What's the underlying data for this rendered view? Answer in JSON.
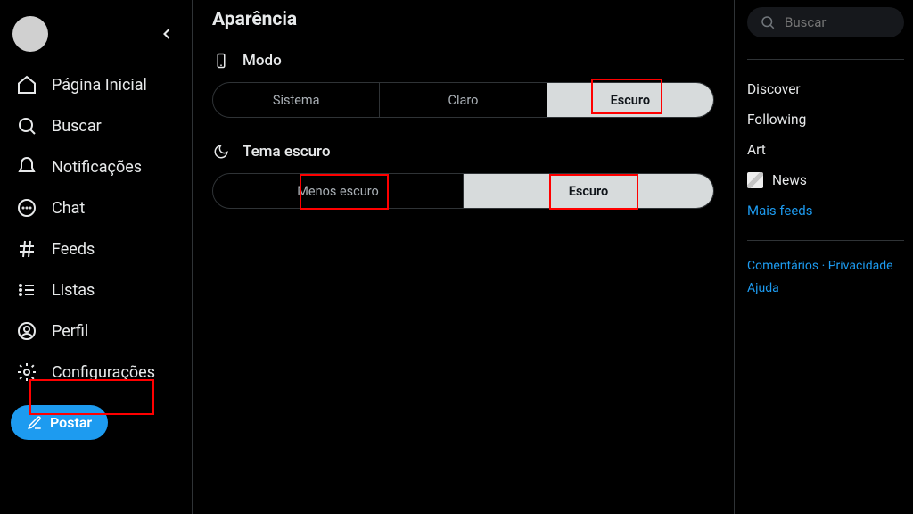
{
  "sidebar": {
    "nav": [
      {
        "label": "Página Inicial"
      },
      {
        "label": "Buscar"
      },
      {
        "label": "Notificações"
      },
      {
        "label": "Chat"
      },
      {
        "label": "Feeds"
      },
      {
        "label": "Listas"
      },
      {
        "label": "Perfil"
      },
      {
        "label": "Configurações"
      }
    ],
    "post_label": "Postar"
  },
  "main": {
    "title": "Aparência",
    "mode_section": "Modo",
    "mode_options": [
      "Sistema",
      "Claro",
      "Escuro"
    ],
    "dark_section": "Tema escuro",
    "dark_options": [
      "Menos escuro",
      "Escuro"
    ]
  },
  "right": {
    "search_placeholder": "Buscar",
    "feeds": [
      "Discover",
      "Following",
      "Art"
    ],
    "news_label": "News",
    "more_feeds": "Mais feeds",
    "footer": {
      "comments": "Comentários",
      "privacy": "Privacidade",
      "help": "Ajuda"
    }
  }
}
